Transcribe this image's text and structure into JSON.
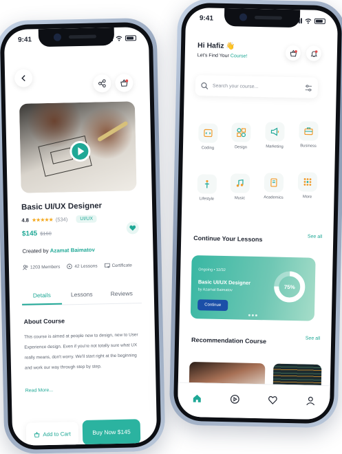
{
  "status": {
    "time": "9:41"
  },
  "detail": {
    "title": "Basic UI/UX Designer",
    "rating": "4.8",
    "stars": "★★★★★",
    "reviews": "(534)",
    "tag": "UI/UX",
    "price": "$145",
    "old_price": "$160",
    "created_prefix": "Created by",
    "author": "Azamat Baimatov",
    "members": "1203 Members",
    "lessons": "42 Lessons",
    "certificate": "Certificate",
    "tabs": [
      "Details",
      "Lessons",
      "Reviews"
    ],
    "about_title": "About Course",
    "about_text": "This course is aimed at people new to design, new to User Experience design. Even if you're not totally sure what UX really means, don't worry. We'll start right at the beginning and work our way through step by step.",
    "read_more": "Read More...",
    "add_to_cart": "Add to Cart",
    "buy_now": "Buy Now $145"
  },
  "home": {
    "greeting": "Hi Hafiz 👋",
    "subtitle_prefix": "Let's Find Your",
    "subtitle_accent": "Course!",
    "search_placeholder": "Search your course...",
    "categories": [
      "Coding",
      "Design",
      "Marketing",
      "Business",
      "Lifestyle",
      "Music",
      "Academics",
      "More"
    ],
    "continue_title": "Continue Your Lessons",
    "see_all": "See all",
    "lesson": {
      "progress_label": "Ongoing • 32/32",
      "title": "Basic UI/UX Designer",
      "author": "by Azamat Baimatov",
      "button": "Continue",
      "percent_text": "75%",
      "percent": 75
    },
    "recommend_title": "Recommendation Course"
  },
  "colors": {
    "accent": "#1fa896",
    "accent_btn": "#2bb3a0",
    "continue_btn": "#1b4fa8",
    "bell_dot": "#e24c4c"
  }
}
